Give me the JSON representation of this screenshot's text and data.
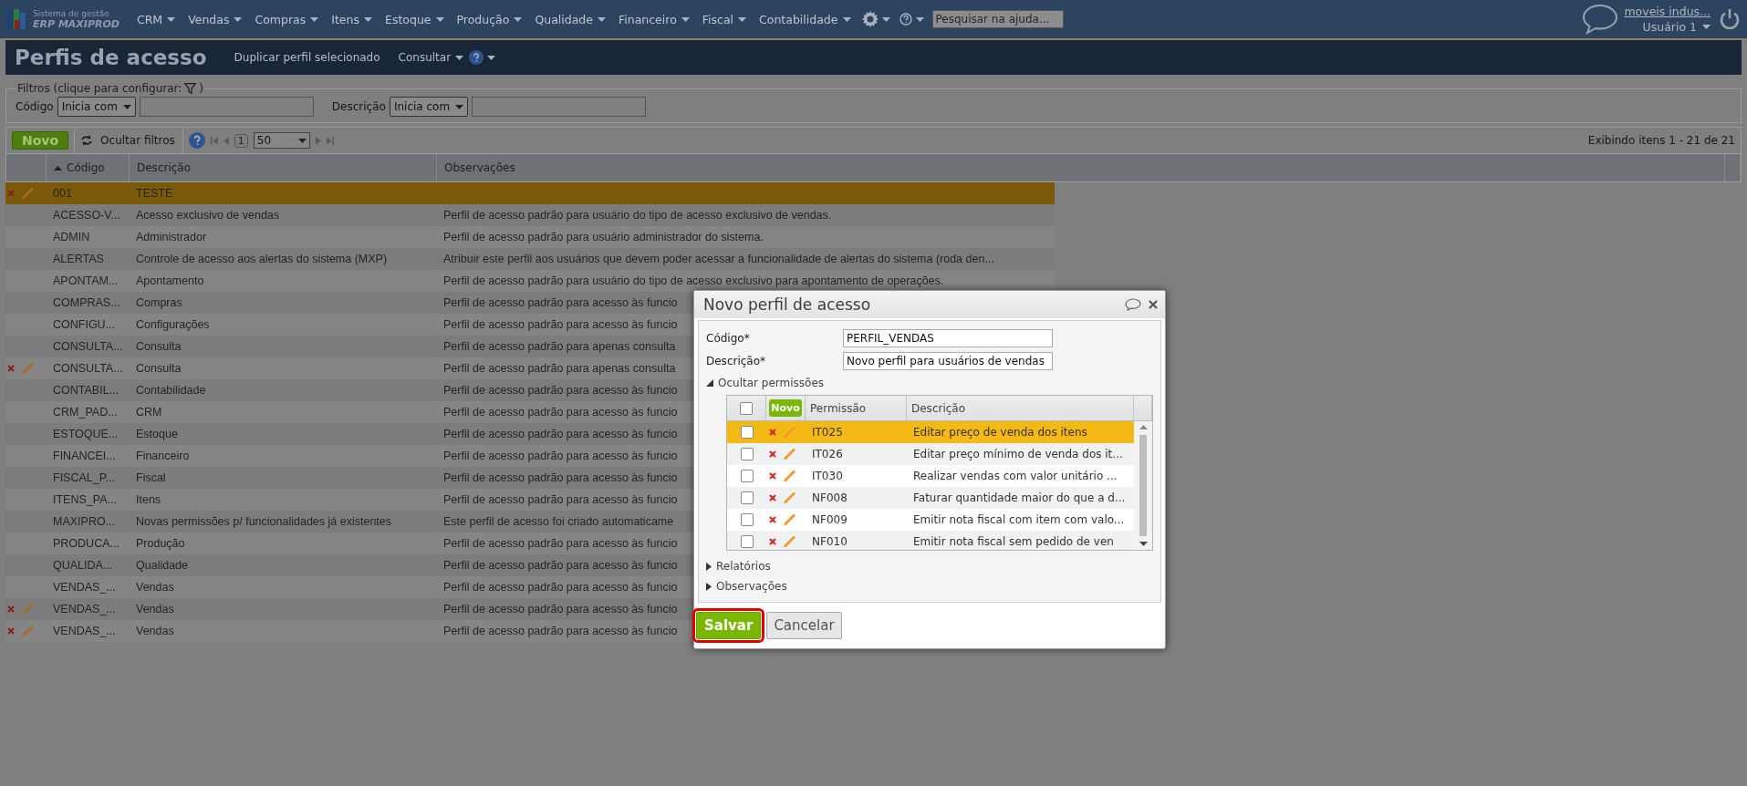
{
  "topbar": {
    "logo_line1": "Sistema de gestão",
    "logo_line2": "ERP MAXIPROD",
    "menus": [
      "CRM",
      "Vendas",
      "Compras",
      "Itens",
      "Estoque",
      "Produção",
      "Qualidade",
      "Financeiro",
      "Fiscal",
      "Contabilidade"
    ],
    "search": {
      "placeholder": "Pesquisar na ajuda..."
    },
    "company": "moveis indus...",
    "user": "Usuário 1"
  },
  "page": {
    "title": "Perfis de acesso",
    "actions": [
      "Duplicar perfil selecionado",
      "Consultar"
    ]
  },
  "filters": {
    "legend": "Filtros (clique para configurar:",
    "legend_end": ")",
    "fields": [
      {
        "label": "Código",
        "operator": "Inicia com"
      },
      {
        "label": "Descrição",
        "operator": "Inicia com"
      }
    ]
  },
  "toolbar": {
    "new": "Novo",
    "hide_filters": "Ocultar filtros",
    "page": "1",
    "page_size": "50",
    "summary": "Exibindo itens 1 - 21 de 21"
  },
  "table": {
    "columns": [
      "Código",
      "Descrição",
      "Observações"
    ],
    "rows": [
      {
        "code": "001",
        "description": "TESTE",
        "notes": "",
        "selected": true,
        "editable": true
      },
      {
        "code": "ACESSO-V...",
        "description": "Acesso exclusivo de vendas",
        "notes": "Perfil de acesso padrão para usuário do tipo de acesso exclusivo de vendas.",
        "selected": false,
        "editable": false
      },
      {
        "code": "ADMIN",
        "description": "Administrador",
        "notes": "Perfil de acesso padrão para usuário administrador do sistema.",
        "selected": false,
        "editable": false
      },
      {
        "code": "ALERTAS",
        "description": "Controle de acesso aos alertas do sistema (MXP)",
        "notes": "Atribuir este perfil aos usuários que devem poder acessar a funcionalidade de alertas do sistema (roda den...",
        "selected": false,
        "editable": false
      },
      {
        "code": "APONTAM...",
        "description": "Apontamento",
        "notes": "Perfil de acesso padrão para usuário do tipo de acesso exclusivo para apontamento de operações.",
        "selected": false,
        "editable": false
      },
      {
        "code": "COMPRAS...",
        "description": "Compras",
        "notes": "Perfil de acesso padrão para acesso às funcio",
        "selected": false,
        "editable": false
      },
      {
        "code": "CONFIGU...",
        "description": "Configurações",
        "notes": "Perfil de acesso padrão para acesso às funcio",
        "selected": false,
        "editable": false
      },
      {
        "code": "CONSULTA...",
        "description": "Consulta",
        "notes": "Perfil de acesso padrão para apenas consulta",
        "selected": false,
        "editable": false
      },
      {
        "code": "CONSULTA...",
        "description": "Consulta",
        "notes": "Perfil de acesso padrão para apenas consulta",
        "selected": false,
        "editable": true
      },
      {
        "code": "CONTABIL...",
        "description": "Contabilidade",
        "notes": "Perfil de acesso padrão para acesso às funcio",
        "selected": false,
        "editable": false
      },
      {
        "code": "CRM_PAD...",
        "description": "CRM",
        "notes": "Perfil de acesso padrão para acesso às funcio",
        "selected": false,
        "editable": false
      },
      {
        "code": "ESTOQUE...",
        "description": "Estoque",
        "notes": "Perfil de acesso padrão para acesso às funcio",
        "selected": false,
        "editable": false
      },
      {
        "code": "FINANCEI...",
        "description": "Financeiro",
        "notes": "Perfil de acesso padrão para acesso às funcio",
        "selected": false,
        "editable": false
      },
      {
        "code": "FISCAL_P...",
        "description": "Fiscal",
        "notes": "Perfil de acesso padrão para acesso às funcio",
        "selected": false,
        "editable": false
      },
      {
        "code": "ITENS_PA...",
        "description": "Itens",
        "notes": "Perfil de acesso padrão para acesso às funcio",
        "selected": false,
        "editable": false
      },
      {
        "code": "MAXIPRO...",
        "description": "Novas permissões p/ funcionalidades já existentes",
        "notes": "Este perfil de acesso foi criado automaticame",
        "selected": false,
        "editable": false
      },
      {
        "code": "PRODUCA...",
        "description": "Produção",
        "notes": "Perfil de acesso padrão para acesso às funcio",
        "selected": false,
        "editable": false
      },
      {
        "code": "QUALIDA...",
        "description": "Qualidade",
        "notes": "Perfil de acesso padrão para acesso às funcio",
        "selected": false,
        "editable": false
      },
      {
        "code": "VENDAS_...",
        "description": "Vendas",
        "notes": "Perfil de acesso padrão para acesso às funcio",
        "selected": false,
        "editable": false
      },
      {
        "code": "VENDAS_...",
        "description": "Vendas",
        "notes": "Perfil de acesso padrão para acesso às funcio",
        "selected": false,
        "editable": true
      },
      {
        "code": "VENDAS_...",
        "description": "Vendas",
        "notes": "Perfil de acesso padrão para acesso às funcio",
        "selected": false,
        "editable": true
      }
    ]
  },
  "dialog": {
    "title": "Novo perfil de acesso",
    "fields": [
      {
        "label": "Código*",
        "value": "PERFIL_VENDAS"
      },
      {
        "label": "Descrição*",
        "value": "Novo perfil para usuários de vendas"
      }
    ],
    "permissions": {
      "toggle": "Ocultar permissões",
      "expanded": true,
      "select_all_checked": false,
      "new": "Novo",
      "columns": [
        "Permissão",
        "Descrição"
      ],
      "rows": [
        {
          "code": "IT025",
          "description": "Editar preço de venda dos itens",
          "checked": false,
          "selected": true
        },
        {
          "code": "IT026",
          "description": "Editar preço mínimo de venda dos it...",
          "checked": false,
          "selected": false
        },
        {
          "code": "IT030",
          "description": "Realizar vendas com valor unitário ...",
          "checked": false,
          "selected": false
        },
        {
          "code": "NF008",
          "description": "Faturar quantidade maior do que a d...",
          "checked": false,
          "selected": false
        },
        {
          "code": "NF009",
          "description": "Emitir nota fiscal com item com valo...",
          "checked": false,
          "selected": false
        },
        {
          "code": "NF010",
          "description": "Emitir nota fiscal sem pedido de ven",
          "checked": false,
          "selected": false
        }
      ]
    },
    "sections": [
      {
        "label": "Relatórios",
        "expanded": false
      },
      {
        "label": "Observações",
        "expanded": false
      }
    ],
    "buttons": [
      {
        "label": "Salvar",
        "kind": "primary",
        "highlighted": true
      },
      {
        "label": "Cancelar",
        "kind": "secondary",
        "highlighted": false
      }
    ]
  }
}
